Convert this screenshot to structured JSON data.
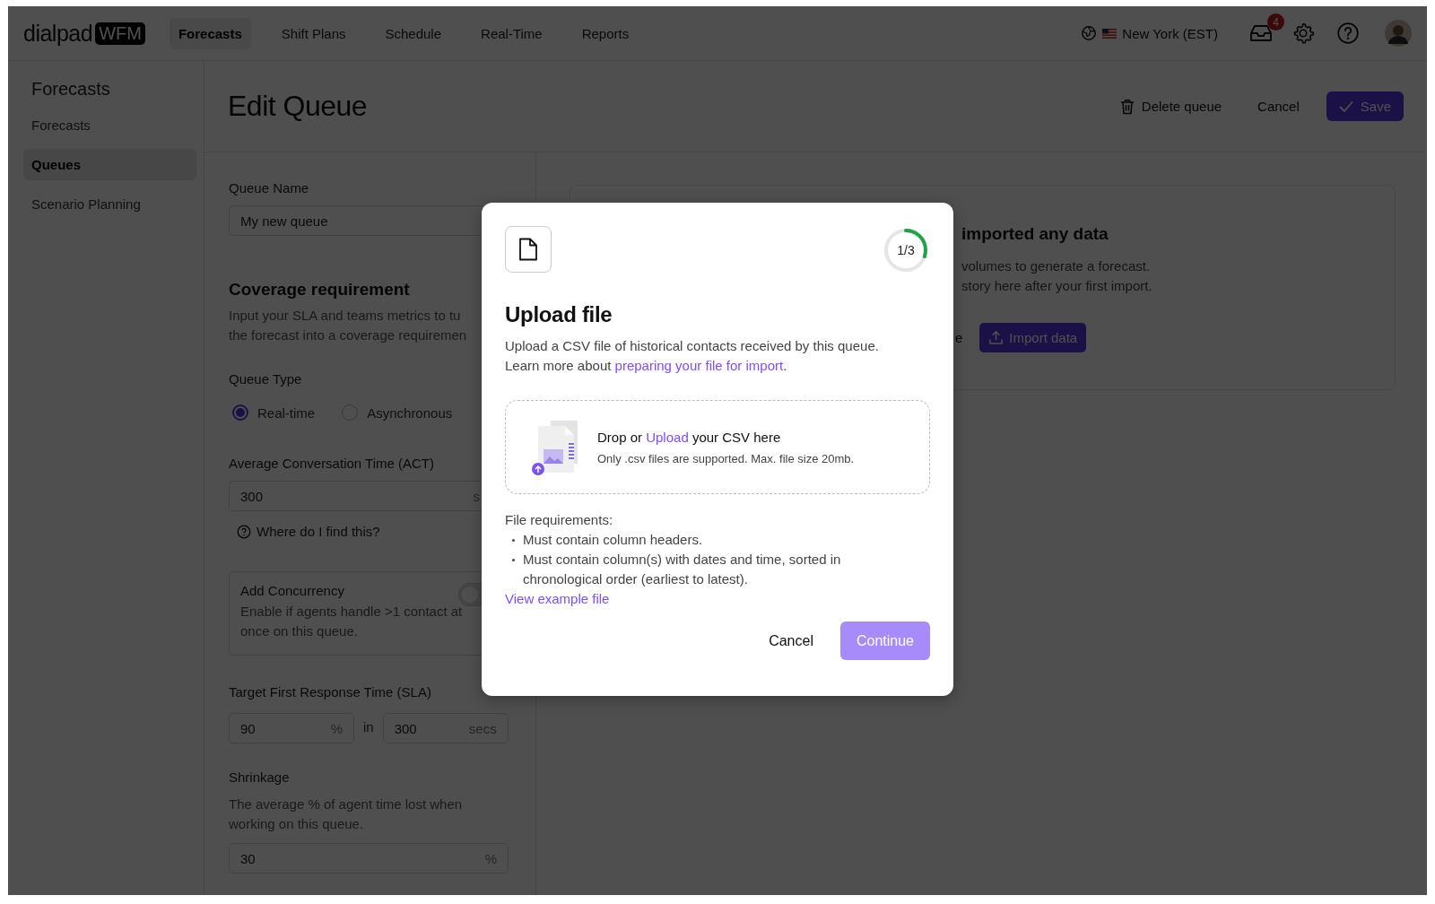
{
  "topbar": {
    "logo": {
      "word": "dialpad",
      "badge": "WFM"
    },
    "nav": [
      {
        "label": "Forecasts",
        "selected": true
      },
      {
        "label": "Shift Plans",
        "selected": false
      },
      {
        "label": "Schedule",
        "selected": false
      },
      {
        "label": "Real-Time",
        "selected": false
      },
      {
        "label": "Reports",
        "selected": false
      }
    ],
    "timezone": "New York (EST)",
    "inbox_badge": "4"
  },
  "sidebar": {
    "title": "Forecasts",
    "items": [
      {
        "label": "Forecasts",
        "selected": false
      },
      {
        "label": "Queues",
        "selected": true
      },
      {
        "label": "Scenario Planning",
        "selected": false
      }
    ]
  },
  "header": {
    "title": "Edit Queue",
    "delete": "Delete queue",
    "cancel": "Cancel",
    "save": "Save"
  },
  "form": {
    "queue_name": {
      "label": "Queue Name",
      "value": "My new queue"
    },
    "coverage": {
      "title": "Coverage requirement",
      "lines": [
        "Input your SLA and teams metrics to tu",
        "the forecast into a coverage requiremen"
      ]
    },
    "queue_type": {
      "label": "Queue Type",
      "options": [
        {
          "label": "Real-time",
          "selected": true
        },
        {
          "label": "Asynchronous",
          "selected": false
        }
      ]
    },
    "act": {
      "label": "Average Conversation Time (ACT)",
      "value": "300",
      "suffix": "s",
      "help": "Where do I find this?"
    },
    "concurrency": {
      "title": "Add Concurrency",
      "lines": [
        "Enable if agents handle >1 contact at",
        "once on this queue."
      ],
      "on": false
    },
    "sla": {
      "label": "Target First Response Time (SLA)",
      "percent": "90",
      "percent_suffix": "%",
      "joiner": "in",
      "time": "300",
      "time_suffix": "secs"
    },
    "shrinkage": {
      "label": "Shrinkage",
      "lines": [
        "The average % of agent time lost when",
        "working on this queue."
      ],
      "value": "30",
      "suffix": "%"
    }
  },
  "empty_card": {
    "title": "imported any data",
    "lines": [
      "volumes to generate a forecast.",
      "story here after your first import."
    ],
    "fragment": "e",
    "button": "Import data"
  },
  "modal": {
    "step": "1/3",
    "level": 0.3,
    "title": "Upload file",
    "description": "Upload a CSV file of historical contacts received by this queue.",
    "learn_prefix": "Learn more about",
    "learn_link": "preparing your file for import",
    "learn_suffix": ".",
    "drop": {
      "prefix": "Drop or",
      "link": "Upload",
      "suffix": "your CSV here",
      "hint": "Only .csv files are supported. Max. file size 20mb."
    },
    "requirements_title": "File requirements:",
    "requirements": [
      "Must contain column headers.",
      "Must contain column(s) with dates and time, sorted in chronological order (earliest to latest)."
    ],
    "example_link": "View example file",
    "cancel": "Cancel",
    "continue": "Continue",
    "continue_disabled": true
  }
}
